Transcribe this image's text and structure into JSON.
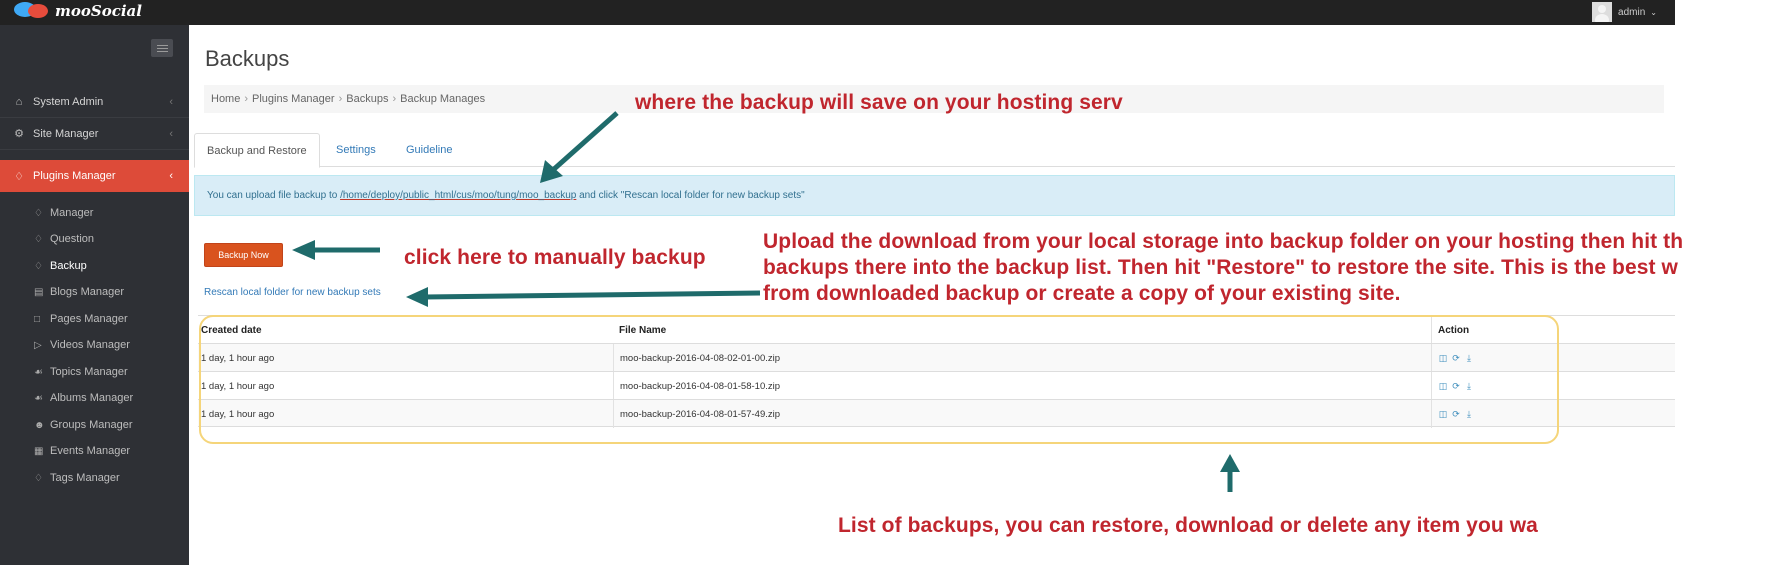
{
  "app": {
    "name": "mooSocial",
    "user": "admin"
  },
  "sidebar": {
    "main": [
      {
        "label": "System Admin",
        "icon": "home-icon"
      },
      {
        "label": "Site Manager",
        "icon": "gears-icon"
      },
      {
        "label": "Plugins Manager",
        "icon": "plugin-tag-icon",
        "active": true
      }
    ],
    "sub": [
      {
        "label": "Manager"
      },
      {
        "label": "Question"
      },
      {
        "label": "Backup",
        "current": true
      },
      {
        "label": "Blogs Manager"
      },
      {
        "label": "Pages Manager"
      },
      {
        "label": "Videos Manager"
      },
      {
        "label": "Topics Manager"
      },
      {
        "label": "Albums Manager"
      },
      {
        "label": "Groups Manager"
      },
      {
        "label": "Events Manager"
      },
      {
        "label": "Tags Manager"
      }
    ]
  },
  "page": {
    "title": "Backups",
    "breadcrumb": [
      "Home",
      "Plugins Manager",
      "Backups",
      "Backup Manages"
    ],
    "tabs": [
      "Backup and Restore",
      "Settings",
      "Guideline"
    ],
    "info": {
      "prefix": "You can upload file backup to ",
      "path": "/home/deploy/public_html/cus/moo/tung/moo_backup",
      "suffix": " and click \"Rescan local folder for new backup sets\""
    },
    "backup_button": "Backup Now",
    "rescan_link": "Rescan local folder for new backup sets",
    "table": {
      "headers": [
        "Created date",
        "File Name",
        "Action"
      ],
      "rows": [
        {
          "date": "1 day, 1 hour ago",
          "file": "moo-backup-2016-04-08-02-01-00.zip"
        },
        {
          "date": "1 day, 1 hour ago",
          "file": "moo-backup-2016-04-08-01-58-10.zip"
        },
        {
          "date": "1 day, 1 hour ago",
          "file": "moo-backup-2016-04-08-01-57-49.zip"
        }
      ]
    }
  },
  "annotations": {
    "save_location": "where the backup will save on your hosting serv",
    "manual_backup": "click here to manually backup",
    "upload_line1": "Upload the download from your local storage into backup folder on your hosting then hit th",
    "upload_line2": "backups there into the backup list. Then hit \"Restore\" to restore the site. This is the best w",
    "upload_line3": "from downloaded backup or create a copy of your existing site.",
    "list_note": "List of backups, you can restore, download or delete any item you wa"
  },
  "colors": {
    "topbar": "#222222",
    "sidebar": "#2e3035",
    "active_nav": "#dd4b39",
    "button": "#d9531e",
    "annotation_text": "#c0262e",
    "arrow": "#1f6b6b",
    "highlight_box": "#f5d57a"
  }
}
